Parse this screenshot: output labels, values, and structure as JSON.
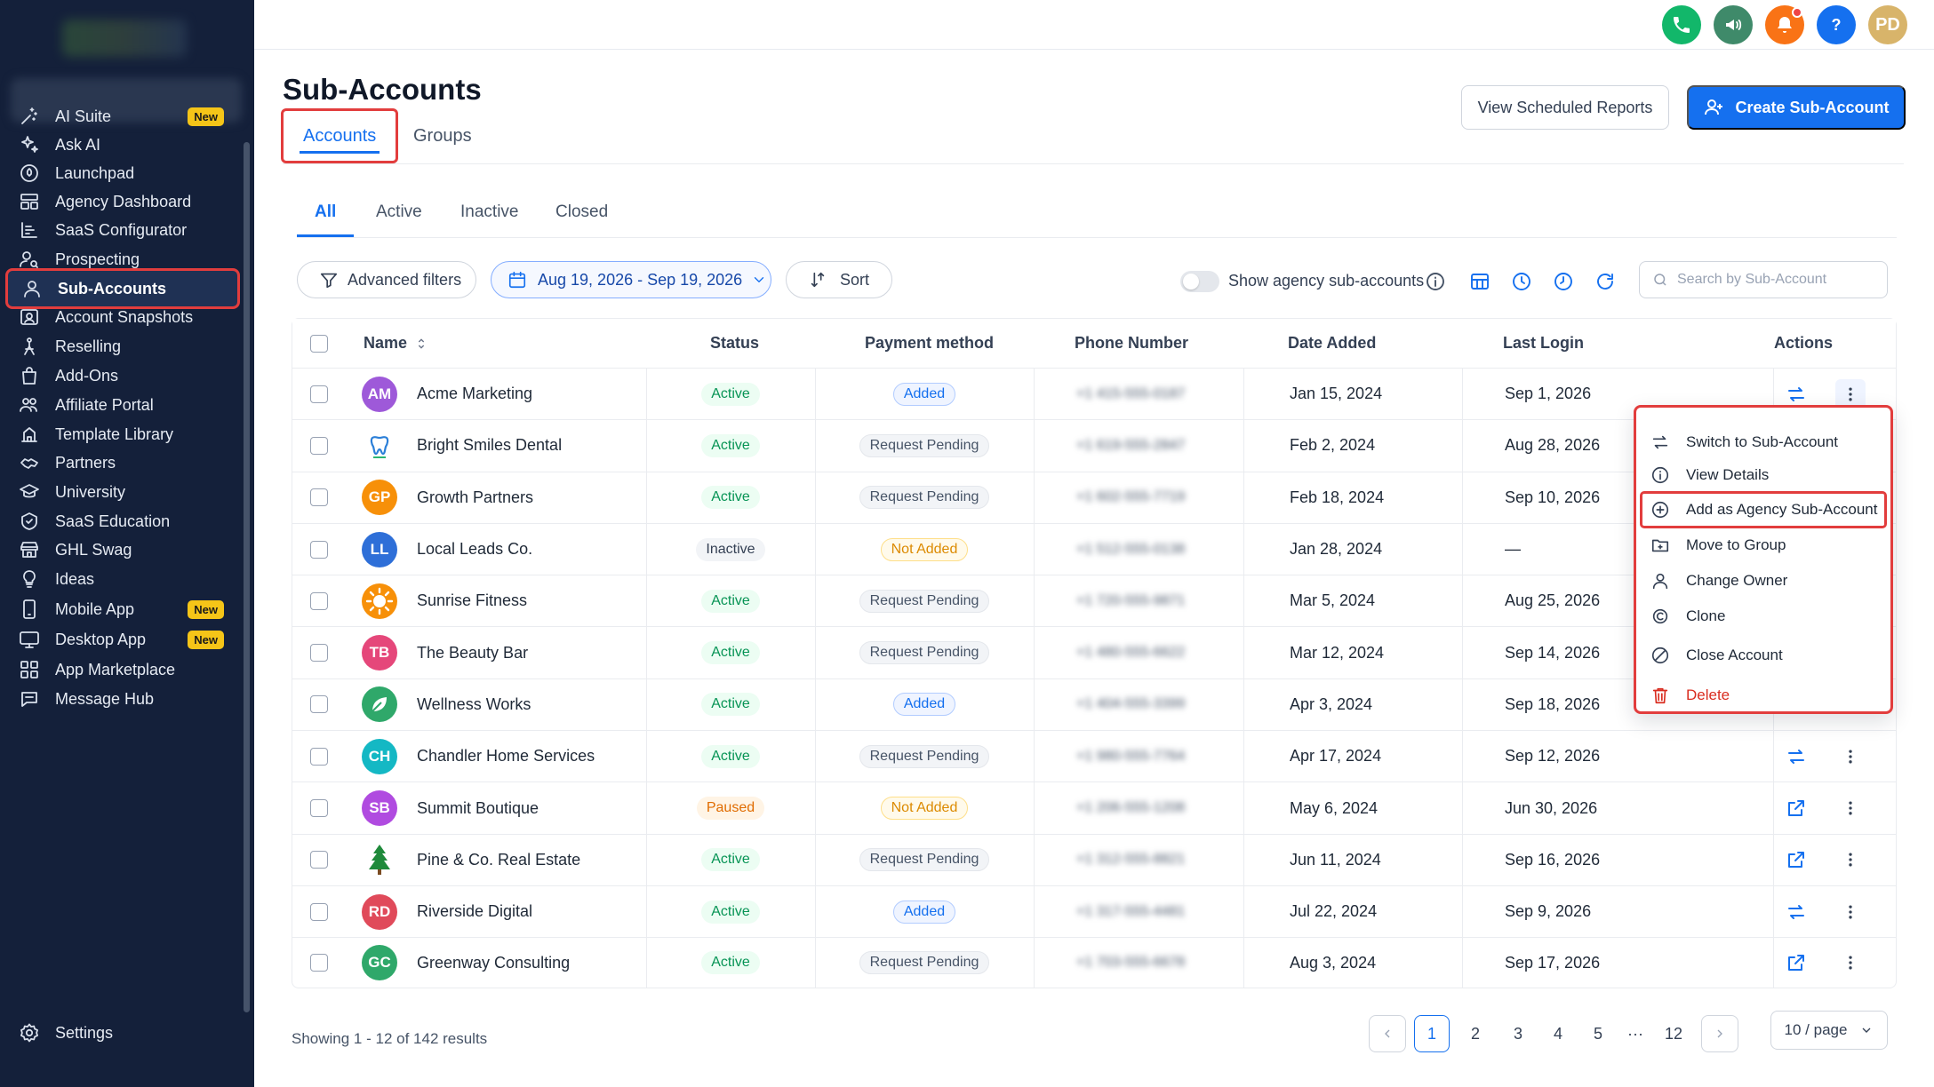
{
  "sidebar": {
    "items": [
      {
        "label": "AI Suite",
        "icon": "sparkle-wand-icon",
        "badge": "New"
      },
      {
        "label": "Ask AI",
        "icon": "sparkles-icon"
      },
      {
        "label": "Launchpad",
        "icon": "rocket-icon"
      },
      {
        "label": "Agency Dashboard",
        "icon": "dashboard-icon"
      },
      {
        "label": "SaaS Configurator",
        "icon": "bar-list-icon"
      },
      {
        "label": "Prospecting",
        "icon": "user-search-icon"
      },
      {
        "label": "Sub-Accounts",
        "icon": "user-icon",
        "active": true
      },
      {
        "label": "Account Snapshots",
        "icon": "snapshot-icon"
      },
      {
        "label": "Reselling",
        "icon": "reselling-icon"
      },
      {
        "label": "Add-Ons",
        "icon": "bag-icon"
      },
      {
        "label": "Affiliate Portal",
        "icon": "users-icon"
      },
      {
        "label": "Template Library",
        "icon": "template-icon"
      },
      {
        "label": "Partners",
        "icon": "handshake-icon"
      },
      {
        "label": "University",
        "icon": "graduation-cap-icon"
      },
      {
        "label": "SaaS Education",
        "icon": "education-icon"
      },
      {
        "label": "GHL Swag",
        "icon": "store-icon"
      },
      {
        "label": "Ideas",
        "icon": "lightbulb-icon"
      },
      {
        "label": "Mobile App",
        "icon": "mobile-icon",
        "badge": "New"
      },
      {
        "label": "Desktop App",
        "icon": "desktop-icon",
        "badge": "New"
      },
      {
        "label": "App Marketplace",
        "icon": "grid-icon"
      },
      {
        "label": "Message Hub",
        "icon": "chat-icon"
      }
    ],
    "settings": "Settings"
  },
  "topbar": {
    "avatar": "PD",
    "colors": {
      "phone": "#12b76a",
      "announce": "#3f8a6a",
      "bell": "#f97316",
      "help": "#1570ef"
    }
  },
  "header": {
    "title": "Sub-Accounts",
    "tabs": [
      "Accounts",
      "Groups"
    ],
    "view_reports": "View Scheduled Reports",
    "create": "Create Sub-Account"
  },
  "filters": {
    "tabs": [
      "All",
      "Active",
      "Inactive",
      "Closed"
    ],
    "advanced": "Advanced filters",
    "date_range": "Aug 19, 2026 - Sep 19, 2026",
    "sort": "Sort",
    "show_agency": "Show agency sub-accounts",
    "search_placeholder": "Search by Sub-Account"
  },
  "table": {
    "columns": [
      "Name",
      "Status",
      "Payment method",
      "Phone Number",
      "Date Added",
      "Last Login",
      "Actions"
    ],
    "rows": [
      {
        "initials": "AM",
        "color": "#9e59d9",
        "name": "Acme Marketing",
        "status": "Active",
        "payment": "Added",
        "phone": "+1 415-555-0187",
        "date_added": "Jan 15, 2024",
        "last_login": "Sep 1, 2026"
      },
      {
        "initials": "",
        "icon": "tooth-logo-icon",
        "color": "#ffffff",
        "name": "Bright Smiles Dental",
        "status": "Active",
        "payment": "Request Pending",
        "phone": "+1 619-555-2847",
        "date_added": "Feb 2, 2024",
        "last_login": "Aug 28, 2026"
      },
      {
        "initials": "GP",
        "color": "#f79009",
        "name": "Growth Partners",
        "status": "Active",
        "payment": "Request Pending",
        "phone": "+1 602-555-7719",
        "date_added": "Feb 18, 2024",
        "last_login": "Sep 10, 2026"
      },
      {
        "initials": "LL",
        "color": "#2e6fd8",
        "name": "Local Leads Co.",
        "status": "Inactive",
        "payment": "Not Added",
        "phone": "+1 512-555-0138",
        "date_added": "Jan 28, 2024",
        "last_login": "—"
      },
      {
        "initials": "",
        "icon": "sun-logo-icon",
        "color": "#f79009",
        "name": "Sunrise Fitness",
        "status": "Active",
        "payment": "Request Pending",
        "phone": "+1 720-555-9871",
        "date_added": "Mar 5, 2024",
        "last_login": "Aug 25, 2026"
      },
      {
        "initials": "TB",
        "color": "#e5477a",
        "name": "The Beauty Bar",
        "status": "Active",
        "payment": "Request Pending",
        "phone": "+1 480-555-6622",
        "date_added": "Mar 12, 2024",
        "last_login": "Sep 14, 2026"
      },
      {
        "initials": "",
        "icon": "leaf-logo-icon",
        "color": "#2fa86a",
        "name": "Wellness Works",
        "status": "Active",
        "payment": "Added",
        "phone": "+1 404-555-3399",
        "date_added": "Apr 3, 2024",
        "last_login": "Sep 18, 2026"
      },
      {
        "initials": "CH",
        "color": "#14b8c4",
        "name": "Chandler Home Services",
        "status": "Active",
        "payment": "Request Pending",
        "phone": "+1 980-555-7764",
        "date_added": "Apr 17, 2024",
        "last_login": "Sep 12, 2026"
      },
      {
        "initials": "SB",
        "color": "#b04be0",
        "name": "Summit Boutique",
        "status": "Paused",
        "payment": "Not Added",
        "phone": "+1 206-555-1208",
        "date_added": "May 6, 2024",
        "last_login": "Jun 30, 2026"
      },
      {
        "initials": "",
        "icon": "pine-tree-logo-icon",
        "color": "#ffffff",
        "name": "Pine & Co. Real Estate",
        "status": "Active",
        "payment": "Request Pending",
        "phone": "+1 312-555-8821",
        "date_added": "Jun 11, 2024",
        "last_login": "Sep 16, 2026"
      },
      {
        "initials": "RD",
        "color": "#e04a5a",
        "name": "Riverside Digital",
        "status": "Active",
        "payment": "Added",
        "phone": "+1 317-555-4481",
        "date_added": "Jul 22, 2024",
        "last_login": "Sep 9, 2026"
      },
      {
        "initials": "GC",
        "color": "#2fa86a",
        "name": "Greenway Consulting",
        "status": "Active",
        "payment": "Request Pending",
        "phone": "+1 703-555-6678",
        "date_added": "Aug 3, 2024",
        "last_login": "Sep 17, 2026"
      }
    ]
  },
  "menu": {
    "items": [
      {
        "label": "Switch to Sub-Account",
        "icon": "switch-arrows-icon"
      },
      {
        "label": "View Details",
        "icon": "info-circle-icon"
      },
      {
        "label": "Add as Agency Sub-Account",
        "icon": "plus-circle-icon",
        "highlight": true
      },
      {
        "label": "Move to Group",
        "icon": "folder-icon"
      },
      {
        "label": "Change Owner",
        "icon": "user-icon"
      },
      {
        "label": "Clone",
        "icon": "clone-icon"
      },
      {
        "label": "Close Account",
        "icon": "ban-icon"
      },
      {
        "label": "Delete",
        "icon": "trash-icon",
        "danger": true
      }
    ]
  },
  "footer": {
    "showing": "Showing 1 - 12 of 142 results",
    "pages": [
      "1",
      "2",
      "3",
      "4",
      "5",
      "···",
      "12"
    ],
    "per_page": "10 / page"
  }
}
